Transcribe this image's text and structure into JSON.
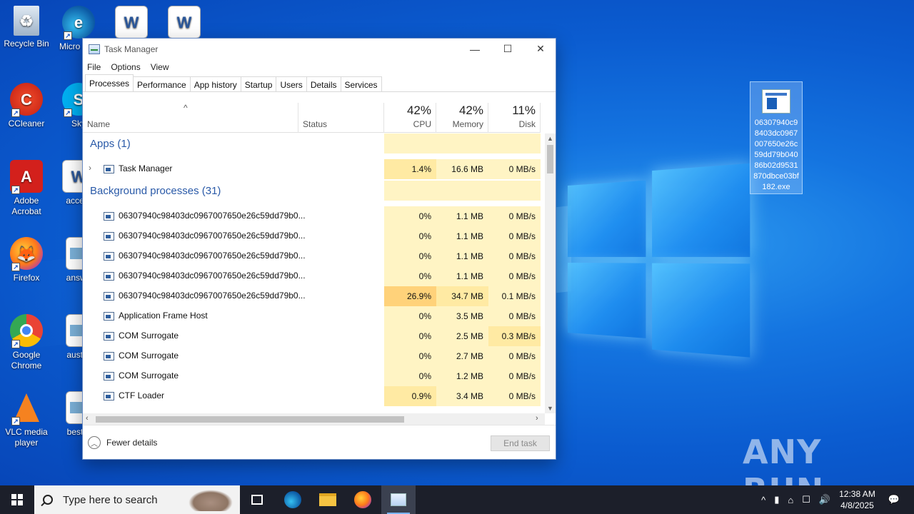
{
  "desktop": {
    "icons": [
      {
        "label": "Recycle Bin"
      },
      {
        "label": "Micro Edg"
      },
      {
        "label": "CCleaner"
      },
      {
        "label": "Sky"
      },
      {
        "label": "Adobe Acrobat"
      },
      {
        "label": "accept"
      },
      {
        "label": "Firefox"
      },
      {
        "label": "answe"
      },
      {
        "label": "Google Chrome"
      },
      {
        "label": "austra"
      },
      {
        "label": "VLC media player"
      },
      {
        "label": "bestm"
      }
    ],
    "selected_file": "06307940c98403dc0967007650e26c59dd79b04086b02d9531870dbce03bf182.exe",
    "watermark": "ANY RUN"
  },
  "taskmanager": {
    "title": "Task Manager",
    "menu": [
      "File",
      "Options",
      "View"
    ],
    "tabs": [
      "Processes",
      "Performance",
      "App history",
      "Startup",
      "Users",
      "Details",
      "Services"
    ],
    "active_tab": "Processes",
    "columns": {
      "name": "Name",
      "status": "Status",
      "cpu": {
        "label": "CPU",
        "pct": "42%"
      },
      "memory": {
        "label": "Memory",
        "pct": "42%"
      },
      "disk": {
        "label": "Disk",
        "pct": "11%"
      }
    },
    "groups": {
      "apps": "Apps (1)",
      "background": "Background processes (31)"
    },
    "rows": [
      {
        "name": "Task Manager",
        "cpu": "1.4%",
        "memory": "16.6 MB",
        "disk": "0 MB/s"
      },
      {
        "name": "06307940c98403dc0967007650e26c59dd79b0...",
        "cpu": "0%",
        "memory": "1.1 MB",
        "disk": "0 MB/s"
      },
      {
        "name": "06307940c98403dc0967007650e26c59dd79b0...",
        "cpu": "0%",
        "memory": "1.1 MB",
        "disk": "0 MB/s"
      },
      {
        "name": "06307940c98403dc0967007650e26c59dd79b0...",
        "cpu": "0%",
        "memory": "1.1 MB",
        "disk": "0 MB/s"
      },
      {
        "name": "06307940c98403dc0967007650e26c59dd79b0...",
        "cpu": "0%",
        "memory": "1.1 MB",
        "disk": "0 MB/s"
      },
      {
        "name": "06307940c98403dc0967007650e26c59dd79b0...",
        "cpu": "26.9%",
        "memory": "34.7 MB",
        "disk": "0.1 MB/s"
      },
      {
        "name": "Application Frame Host",
        "cpu": "0%",
        "memory": "3.5 MB",
        "disk": "0 MB/s"
      },
      {
        "name": "COM Surrogate",
        "cpu": "0%",
        "memory": "2.5 MB",
        "disk": "0.3 MB/s"
      },
      {
        "name": "COM Surrogate",
        "cpu": "0%",
        "memory": "2.7 MB",
        "disk": "0 MB/s"
      },
      {
        "name": "COM Surrogate",
        "cpu": "0%",
        "memory": "1.2 MB",
        "disk": "0 MB/s"
      },
      {
        "name": "CTF Loader",
        "cpu": "0.9%",
        "memory": "3.4 MB",
        "disk": "0 MB/s"
      }
    ],
    "fewer_details": "Fewer details",
    "end_task": "End task"
  },
  "taskbar": {
    "search_placeholder": "Type here to search",
    "time": "12:38 AM",
    "date": "4/8/2025"
  },
  "colors": {
    "cell_light": "#fff4c4",
    "cell_hot": "#ffd27a",
    "group_blue": "#2a5aa8"
  }
}
